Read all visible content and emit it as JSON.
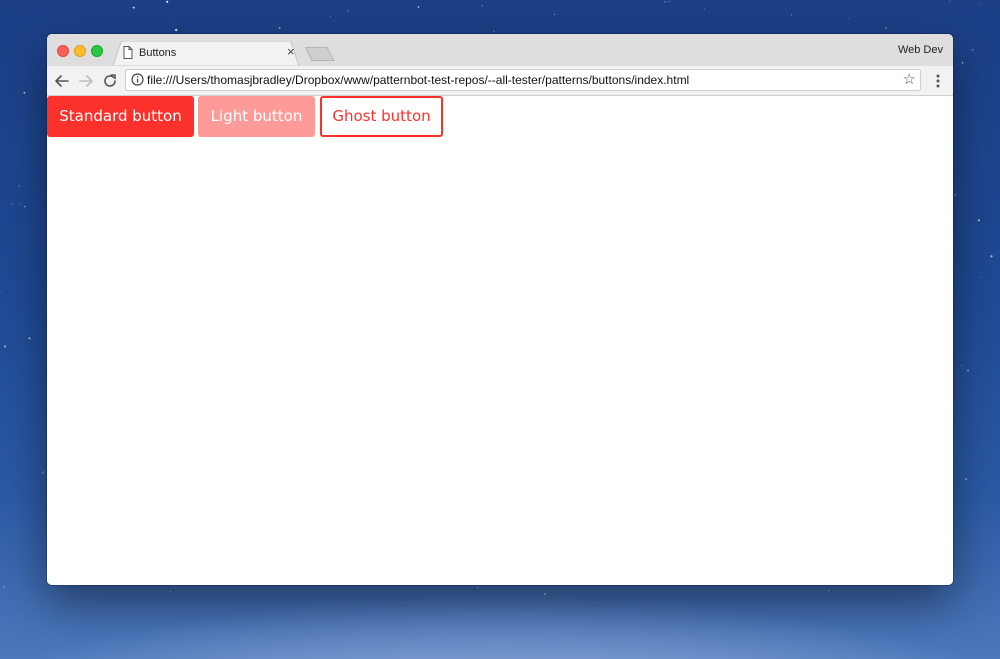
{
  "browser": {
    "tab": {
      "title": "Buttons",
      "close_glyph": "×",
      "icon": "page-icon"
    },
    "profile_label": "Web Dev",
    "address": {
      "url": "file:///Users/thomasjbradley/Dropbox/www/patternbot-test-repos/--all-tester/patterns/buttons/index.html",
      "security_icon": "info-icon",
      "bookmark_glyph": "☆"
    },
    "nav_icons": [
      "back-arrow-icon",
      "forward-arrow-icon",
      "reload-icon"
    ],
    "menu_icon": "kebab-menu-icon"
  },
  "page": {
    "buttons": [
      {
        "label": "Standard button",
        "style": "standard",
        "color": "#fd312b"
      },
      {
        "label": "Light button",
        "style": "light",
        "color": "#fe9a98"
      },
      {
        "label": "Ghost button",
        "style": "ghost",
        "color": "#fd312b"
      }
    ]
  },
  "colors": {
    "accent": "#fd312b",
    "accent_light": "#fe9a98",
    "chrome_tabstrip": "#dedede",
    "chrome_toolbar": "#f2f2f2",
    "desktop": "#1f4a95"
  }
}
